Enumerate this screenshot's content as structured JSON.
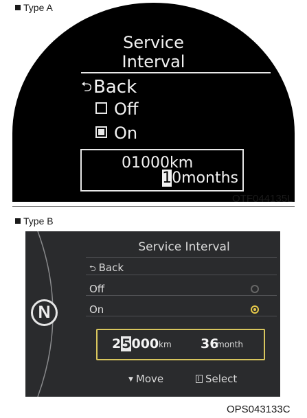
{
  "type_a": {
    "caption": "Type A",
    "title_line1": "Service",
    "title_line2": "Interval",
    "back_label": "Back",
    "off_label": "Off",
    "on_label": "On",
    "selected_option": "On",
    "km_value": "01000km",
    "months_cursor_digit": "1",
    "months_rest": "0months",
    "figure_code": "OTF044135L"
  },
  "type_b": {
    "caption": "Type B",
    "title": "Service Interval",
    "back_label": "Back",
    "off_label": "Off",
    "on_label": "On",
    "selected_option": "On",
    "km_digit_1": "2",
    "km_cursor_digit": "5",
    "km_digits_rest": "000",
    "km_unit": "km",
    "months_value": "36",
    "months_unit": "month",
    "gear_indicator": "N",
    "move_hint": "Move",
    "select_hint": "Select",
    "figure_code": "OPS043133C",
    "accent_color": "#d8c65e"
  }
}
